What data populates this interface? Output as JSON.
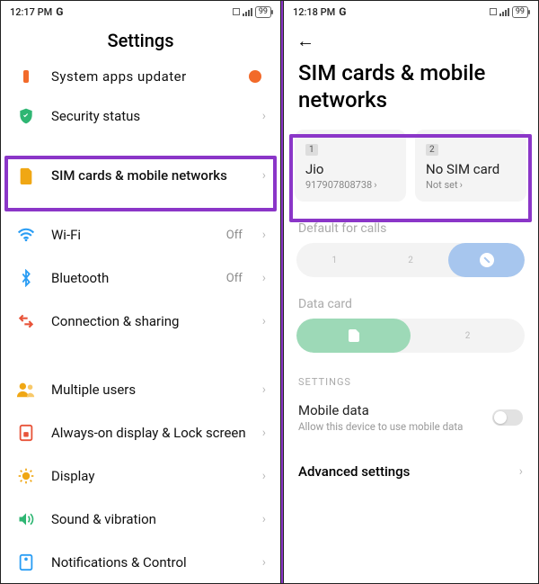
{
  "left": {
    "status": {
      "time": "12:17 PM",
      "g": "G",
      "battery": "99"
    },
    "title": "Settings",
    "items": [
      {
        "icon": "updater-icon",
        "color": "#f26a2a",
        "label": "System apps updater",
        "cutoff": true
      },
      {
        "icon": "shield-icon",
        "color": "#2fb673",
        "label": "Security status"
      },
      {
        "icon": "sim-icon",
        "color": "#f0a714",
        "label": "SIM cards & mobile networks"
      },
      {
        "icon": "wifi-icon",
        "color": "#2a9df4",
        "label": "Wi-Fi",
        "value": "Off"
      },
      {
        "icon": "bluetooth-icon",
        "color": "#2a9df4",
        "label": "Bluetooth",
        "value": "Off"
      },
      {
        "icon": "share-icon",
        "color": "#e8543a",
        "label": "Connection & sharing"
      },
      {
        "icon": "users-icon",
        "color": "#f0a714",
        "label": "Multiple users"
      },
      {
        "icon": "aod-icon",
        "color": "#e8543a",
        "label": "Always-on display & Lock screen"
      },
      {
        "icon": "display-icon",
        "color": "#f0a714",
        "label": "Display"
      },
      {
        "icon": "sound-icon",
        "color": "#2fb673",
        "label": "Sound & vibration"
      },
      {
        "icon": "notif-icon",
        "color": "#2a9df4",
        "label": "Notifications & Control",
        "cutbottom": true
      }
    ]
  },
  "right": {
    "status": {
      "time": "12:18 PM",
      "g": "G",
      "battery": "99"
    },
    "title": "SIM cards & mobile networks",
    "sim1": {
      "slot": "1",
      "name": "Jio",
      "number": "917907808738"
    },
    "sim2": {
      "slot": "2",
      "name": "No SIM card",
      "sub": "Not set"
    },
    "default_calls_label": "Default for calls",
    "seg_calls": {
      "opt1": "1",
      "opt2": "2"
    },
    "data_card_label": "Data card",
    "seg_data": {
      "opt2": "2"
    },
    "settings_header": "SETTINGS",
    "mobile_data": {
      "title": "Mobile data",
      "desc": "Allow this device to use mobile data"
    },
    "advanced": "Advanced settings"
  }
}
